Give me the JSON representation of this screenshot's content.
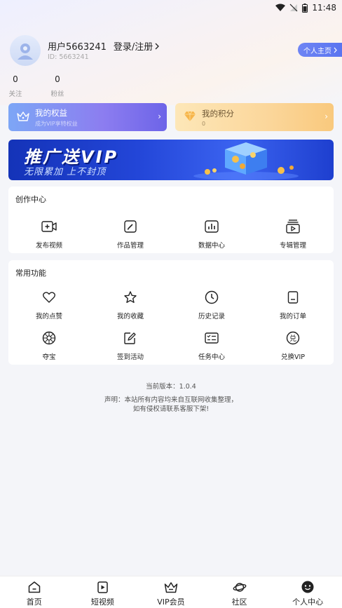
{
  "status": {
    "time": "11:48"
  },
  "profile": {
    "username": "用户5663241",
    "login_label": "登录/注册",
    "uid": "ID: 5663241",
    "homepage_label": "个人主页"
  },
  "stats": [
    {
      "value": "0",
      "label": "关注"
    },
    {
      "value": "0",
      "label": "粉丝"
    }
  ],
  "cards": {
    "rights": {
      "title": "我的权益",
      "subtitle": "成为VIP享特权益"
    },
    "points": {
      "title": "我的积分",
      "subtitle": "0"
    }
  },
  "banner": {
    "title": "推广送VIP",
    "subtitle": "无限累加 上不封顶"
  },
  "creator": {
    "title": "创作中心",
    "items": [
      {
        "label": "发布视频",
        "icon": "video-add-icon"
      },
      {
        "label": "作品管理",
        "icon": "edit-box-icon"
      },
      {
        "label": "数据中心",
        "icon": "chart-icon"
      },
      {
        "label": "专辑管理",
        "icon": "album-icon"
      }
    ]
  },
  "common": {
    "title": "常用功能",
    "items": [
      {
        "label": "我的点赞",
        "icon": "heart-icon"
      },
      {
        "label": "我的收藏",
        "icon": "star-icon"
      },
      {
        "label": "历史记录",
        "icon": "clock-icon"
      },
      {
        "label": "我的订单",
        "icon": "order-icon"
      },
      {
        "label": "夺宝",
        "icon": "treasure-icon"
      },
      {
        "label": "签到活动",
        "icon": "sign-in-icon"
      },
      {
        "label": "任务中心",
        "icon": "task-icon"
      },
      {
        "label": "兑换VIP",
        "icon": "exchange-icon"
      }
    ]
  },
  "footer": {
    "version": "当前版本：1.0.4",
    "disclaimer_line1": "声明：本站所有内容均来自互联网收集整理，",
    "disclaimer_line2": "如有侵权请联系客服下架!"
  },
  "tabs": [
    {
      "label": "首页",
      "icon": "home-icon"
    },
    {
      "label": "短视频",
      "icon": "short-video-icon"
    },
    {
      "label": "VIP会员",
      "icon": "crown-icon"
    },
    {
      "label": "社区",
      "icon": "planet-icon"
    },
    {
      "label": "个人中心",
      "icon": "profile-face-icon"
    }
  ]
}
